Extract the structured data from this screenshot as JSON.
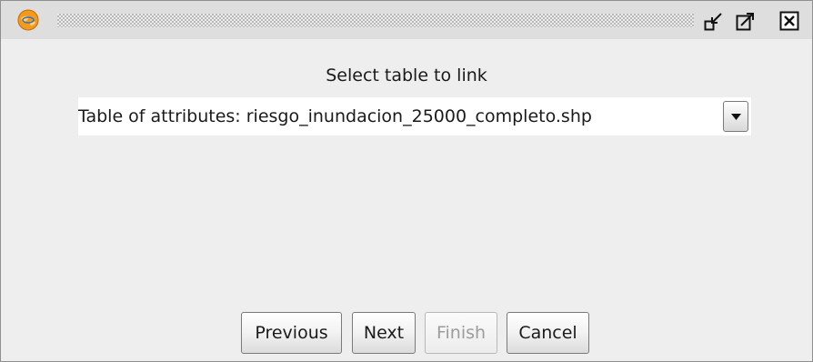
{
  "titlebar": {
    "app_icon": "gvsig-globe-icon",
    "controls": [
      "minimize-icon",
      "maximize-icon",
      "close-icon"
    ]
  },
  "main": {
    "heading": "Select table to link",
    "table_select": {
      "selected": "Table of attributes: riesgo_inundacion_25000_completo.shp"
    }
  },
  "buttons": {
    "previous": "Previous",
    "next": "Next",
    "finish": "Finish",
    "cancel": "Cancel"
  },
  "colors": {
    "window_bg": "#eeeeee",
    "titlebar_bg": "#dedede",
    "disabled_text": "#9c9c9c"
  }
}
